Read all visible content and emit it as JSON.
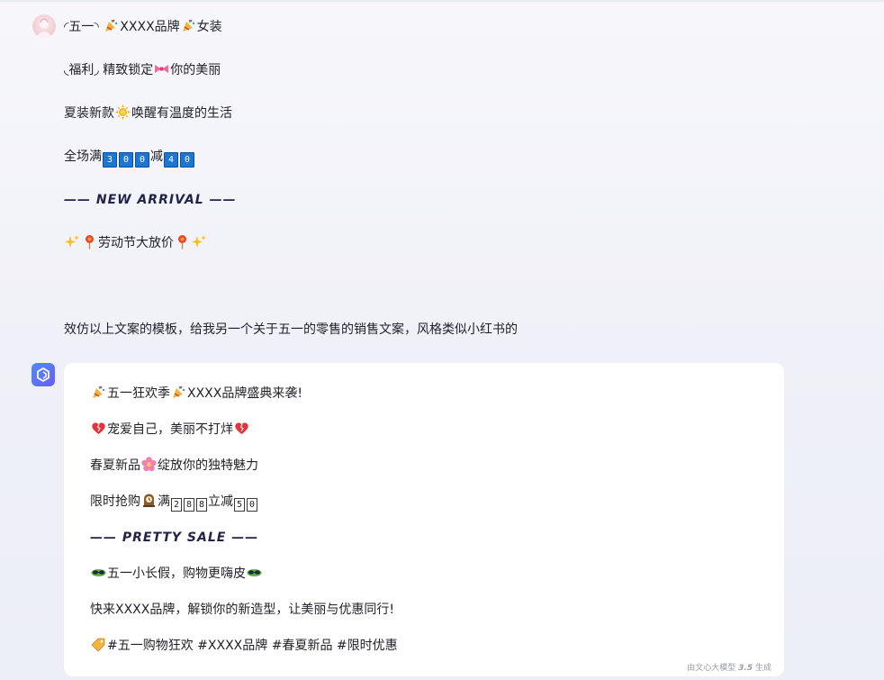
{
  "user_message": {
    "lines": [
      {
        "pre": "◜五一◝",
        "mid": "XXXX品牌",
        "post": "女装"
      },
      {
        "pre": "◟福利◞ 精致锁定",
        "post": "你的美丽"
      },
      {
        "pre": "夏装新款",
        "post": "唤醒有温度的生活"
      },
      {
        "pre": "全场满",
        "digits1": [
          "3",
          "0",
          "0"
        ],
        "mid": "减",
        "digits2": [
          "4",
          "0"
        ]
      },
      {
        "text": "—— NEW ARRIVAL ——"
      },
      {
        "text": "劳动节大放价"
      }
    ],
    "question": "效仿以上文案的模板，给我另一个关于五一的零售的销售文案，风格类似小红书的"
  },
  "bot_reply": {
    "lines": [
      {
        "mid": "五一狂欢季",
        "post": "XXXX品牌盛典来袭!"
      },
      {
        "text": "宠爱自己，美丽不打烊"
      },
      {
        "pre": "春夏新品",
        "post": "绽放你的独特魅力"
      },
      {
        "pre": "限时抢购",
        "mid": "满",
        "digits1": [
          "2",
          "8",
          "8"
        ],
        "mid2": "立减",
        "digits2": [
          "5",
          "0"
        ]
      },
      {
        "text": "—— PRETTY SALE ——"
      },
      {
        "text": "五一小长假，购物更嗨皮"
      },
      {
        "text": "快来XXXX品牌，解锁你的新造型，让美丽与优惠同行!"
      },
      {
        "text": "#五一购物狂欢 #XXXX品牌 #春夏新品 #限时优惠"
      }
    ],
    "footer": {
      "pre": "由文心大模型",
      "version": "3.5",
      "post": "生成"
    }
  },
  "icons": [
    "party-popper-icon",
    "ribbon-icon",
    "sun-icon",
    "sparkles-icon",
    "lollipop-icon",
    "heart-icon",
    "blossom-icon",
    "clock-icon",
    "sunglasses-icon",
    "tag-icon"
  ]
}
